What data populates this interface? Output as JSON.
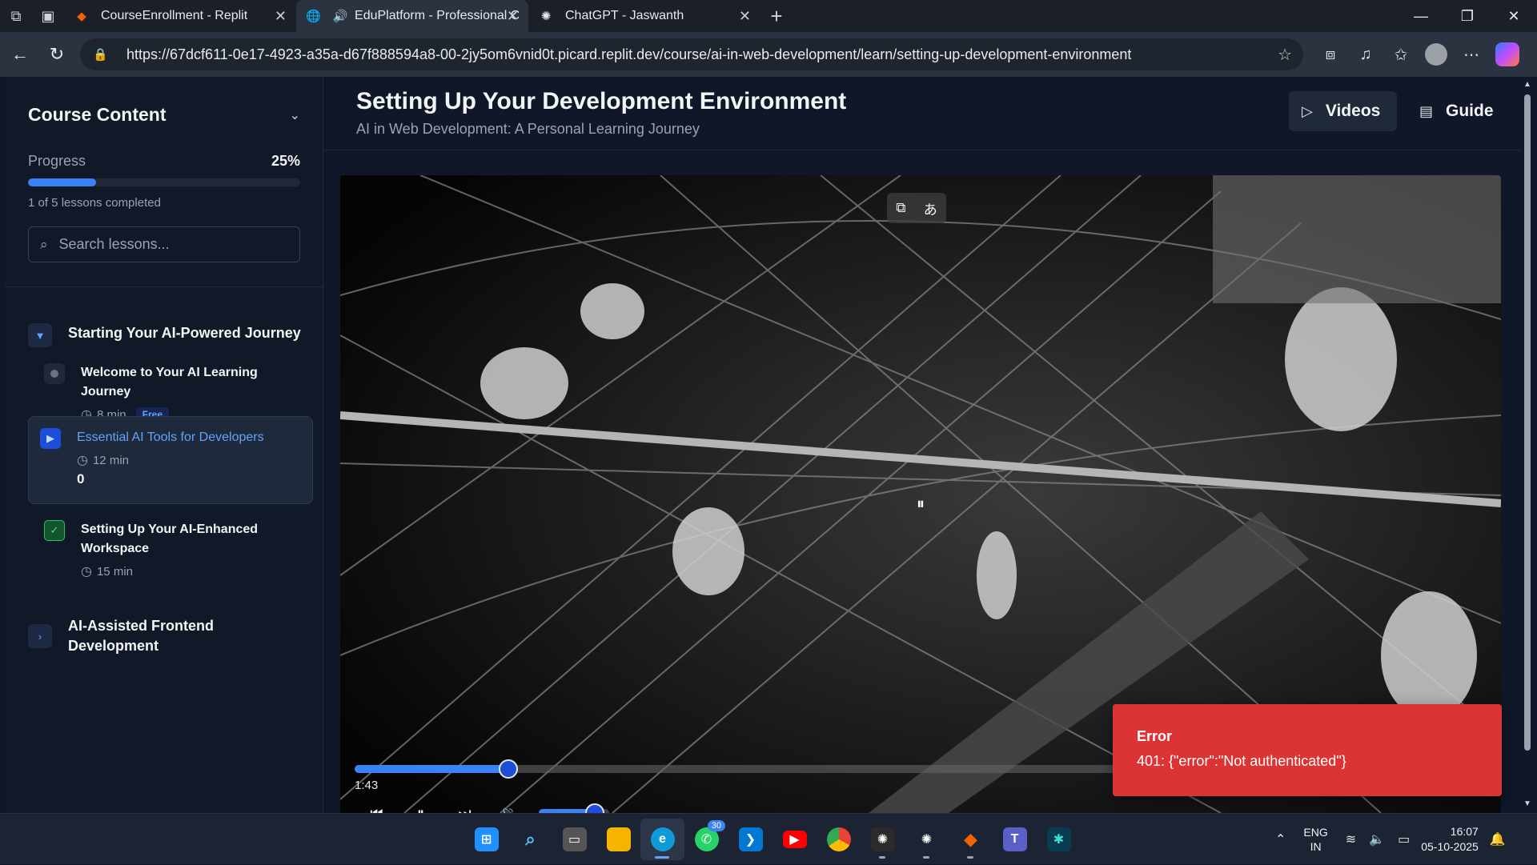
{
  "browser": {
    "tabs": [
      {
        "title": "CourseEnrollment - Replit",
        "icon": "replit-icon",
        "active": false
      },
      {
        "title": "EduPlatform - Professional C",
        "icon": "globe-icon",
        "active": true
      },
      {
        "title": "ChatGPT - Jaswanth",
        "icon": "chatgpt-icon",
        "active": false
      }
    ],
    "url": "https://67dcf611-0e17-4923-a35a-d67f888594a8-00-2jy5om6vnid0t.picard.replit.dev/course/ai-in-web-development/learn/setting-up-development-environment"
  },
  "sidebar": {
    "title": "Course Content",
    "progress_label": "Progress",
    "progress_percent": "25%",
    "progress_value": 0.25,
    "progress_note": "1 of 5 lessons completed",
    "search_placeholder": "Search lessons...",
    "modules": [
      {
        "title": "Starting Your AI-Powered Journey",
        "expanded": true,
        "lessons": [
          {
            "title": "Welcome to Your AI Learning Journey",
            "duration": "8 min",
            "badge": "Free",
            "status": "todo"
          },
          {
            "title": "Essential AI Tools for Developers",
            "duration": "12 min",
            "extra": "0",
            "status": "current"
          },
          {
            "title": "Setting Up Your AI-Enhanced Workspace",
            "duration": "15 min",
            "status": "done"
          }
        ]
      },
      {
        "title": "AI-Assisted Frontend Development",
        "expanded": false
      }
    ]
  },
  "main": {
    "title": "Setting Up Your Development Environment",
    "subtitle": "AI in Web Development: A Personal Learning Journey",
    "videos_label": "Videos",
    "guide_label": "Guide"
  },
  "player": {
    "current_time": "1:43",
    "seek_fraction": 0.19,
    "volume_fraction": 0.8
  },
  "toast": {
    "title": "Error",
    "message": "401: {\"error\":\"Not authenticated\"}",
    "color": "#dc3434"
  },
  "taskbar": {
    "whatsapp_badge": "30",
    "lang_line1": "ENG",
    "lang_line2": "IN",
    "time": "16:07",
    "date": "05-10-2025"
  }
}
